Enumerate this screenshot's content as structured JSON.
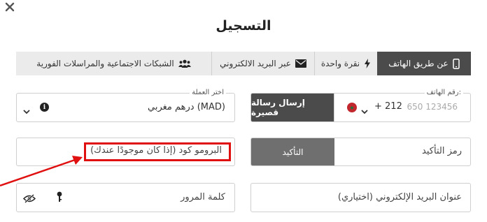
{
  "dialog": {
    "title": "التسجيل",
    "close_icon": "close-icon"
  },
  "tabs": [
    {
      "label": "عن طريق الهاتف",
      "icon": "mobile-phone-icon",
      "active": true
    },
    {
      "label": "نقرة واحدة",
      "icon": "lightning-bolt-icon",
      "active": false
    },
    {
      "label": "عبر البريد الالكتروني",
      "icon": "envelope-icon",
      "active": false
    },
    {
      "label": "الشبكات الاجتماعية والمراسلات الفورية",
      "icon": "users-group-icon",
      "active": false
    }
  ],
  "phone": {
    "label": "رقم الهاتف:",
    "country_code": "+ 212",
    "country_flag": "morocco-flag-icon",
    "placeholder": "650 123456",
    "send_sms_label": "إرسال رسالة قصيرة"
  },
  "currency": {
    "label": "اختر العملة",
    "value": "درهم مغربي (MAD)"
  },
  "confirmation": {
    "placeholder": "رمز التأكيد",
    "button_label": "التأكيد"
  },
  "promo": {
    "placeholder": "البرومو كود (إذا كان موجودًا عندك)"
  },
  "password": {
    "placeholder": "كلمة المرور"
  },
  "email": {
    "placeholder": "عنوان البريد الإلكتروني (اختياري)"
  },
  "colors": {
    "active_tab": "#4b4b4b",
    "inactive_tab": "#ebebeb",
    "highlight": "#e01010"
  }
}
